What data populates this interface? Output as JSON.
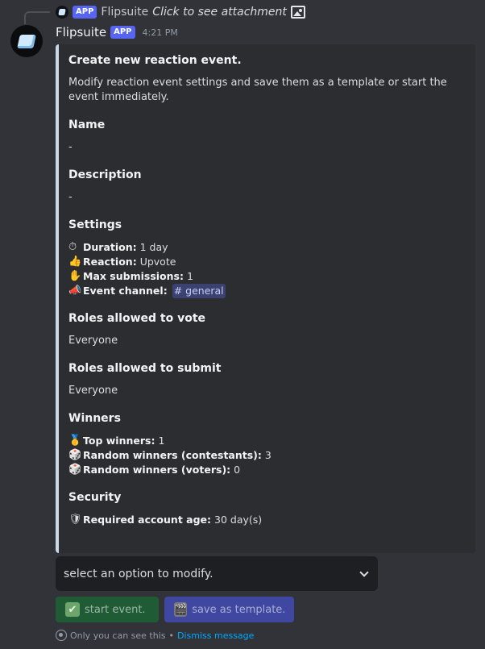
{
  "reply": {
    "app_tag": "APP",
    "author": "Flipsuite",
    "hint": "Click to see attachment"
  },
  "message": {
    "username": "Flipsuite",
    "app_tag": "APP",
    "timestamp": "4:21 PM"
  },
  "embed": {
    "accent_color": "#c9d7e6",
    "title": "Create new reaction event.",
    "description": "Modify reaction event settings and save them as a template or start the event immediately.",
    "name": {
      "label": "Name",
      "value": "-"
    },
    "description_field": {
      "label": "Description",
      "value": "-"
    },
    "settings": {
      "label": "Settings",
      "duration": {
        "emoji": "⏱",
        "label": "Duration:",
        "value": "1 day"
      },
      "reaction": {
        "emoji": "👍",
        "label": "Reaction:",
        "value": "Upvote"
      },
      "max_submissions": {
        "emoji": "✋",
        "label": "Max submissions:",
        "value": "1"
      },
      "event_channel": {
        "emoji": "📣",
        "label": "Event channel:",
        "value": "# general"
      }
    },
    "roles_vote": {
      "label": "Roles allowed to vote",
      "value": "Everyone"
    },
    "roles_submit": {
      "label": "Roles allowed to submit",
      "value": "Everyone"
    },
    "winners": {
      "label": "Winners",
      "top": {
        "emoji": "🥇",
        "label": "Top winners:",
        "value": "1"
      },
      "random_contestants": {
        "emoji": "🎲",
        "label": "Random winners (contestants):",
        "value": "3"
      },
      "random_voters": {
        "emoji": "🎲",
        "label": "Random winners (voters):",
        "value": "0"
      }
    },
    "security": {
      "label": "Security",
      "account_age": {
        "emoji": "🛡",
        "label": "Required account age:",
        "value": "30 day(s)"
      }
    }
  },
  "select": {
    "placeholder": "select an option to modify."
  },
  "buttons": {
    "start": {
      "icon": "✔",
      "label": "start event."
    },
    "save": {
      "icon": "🎬",
      "label": "save as template."
    }
  },
  "ephemeral": {
    "text": "Only you can see this",
    "separator": "•",
    "dismiss": "Dismiss message"
  }
}
